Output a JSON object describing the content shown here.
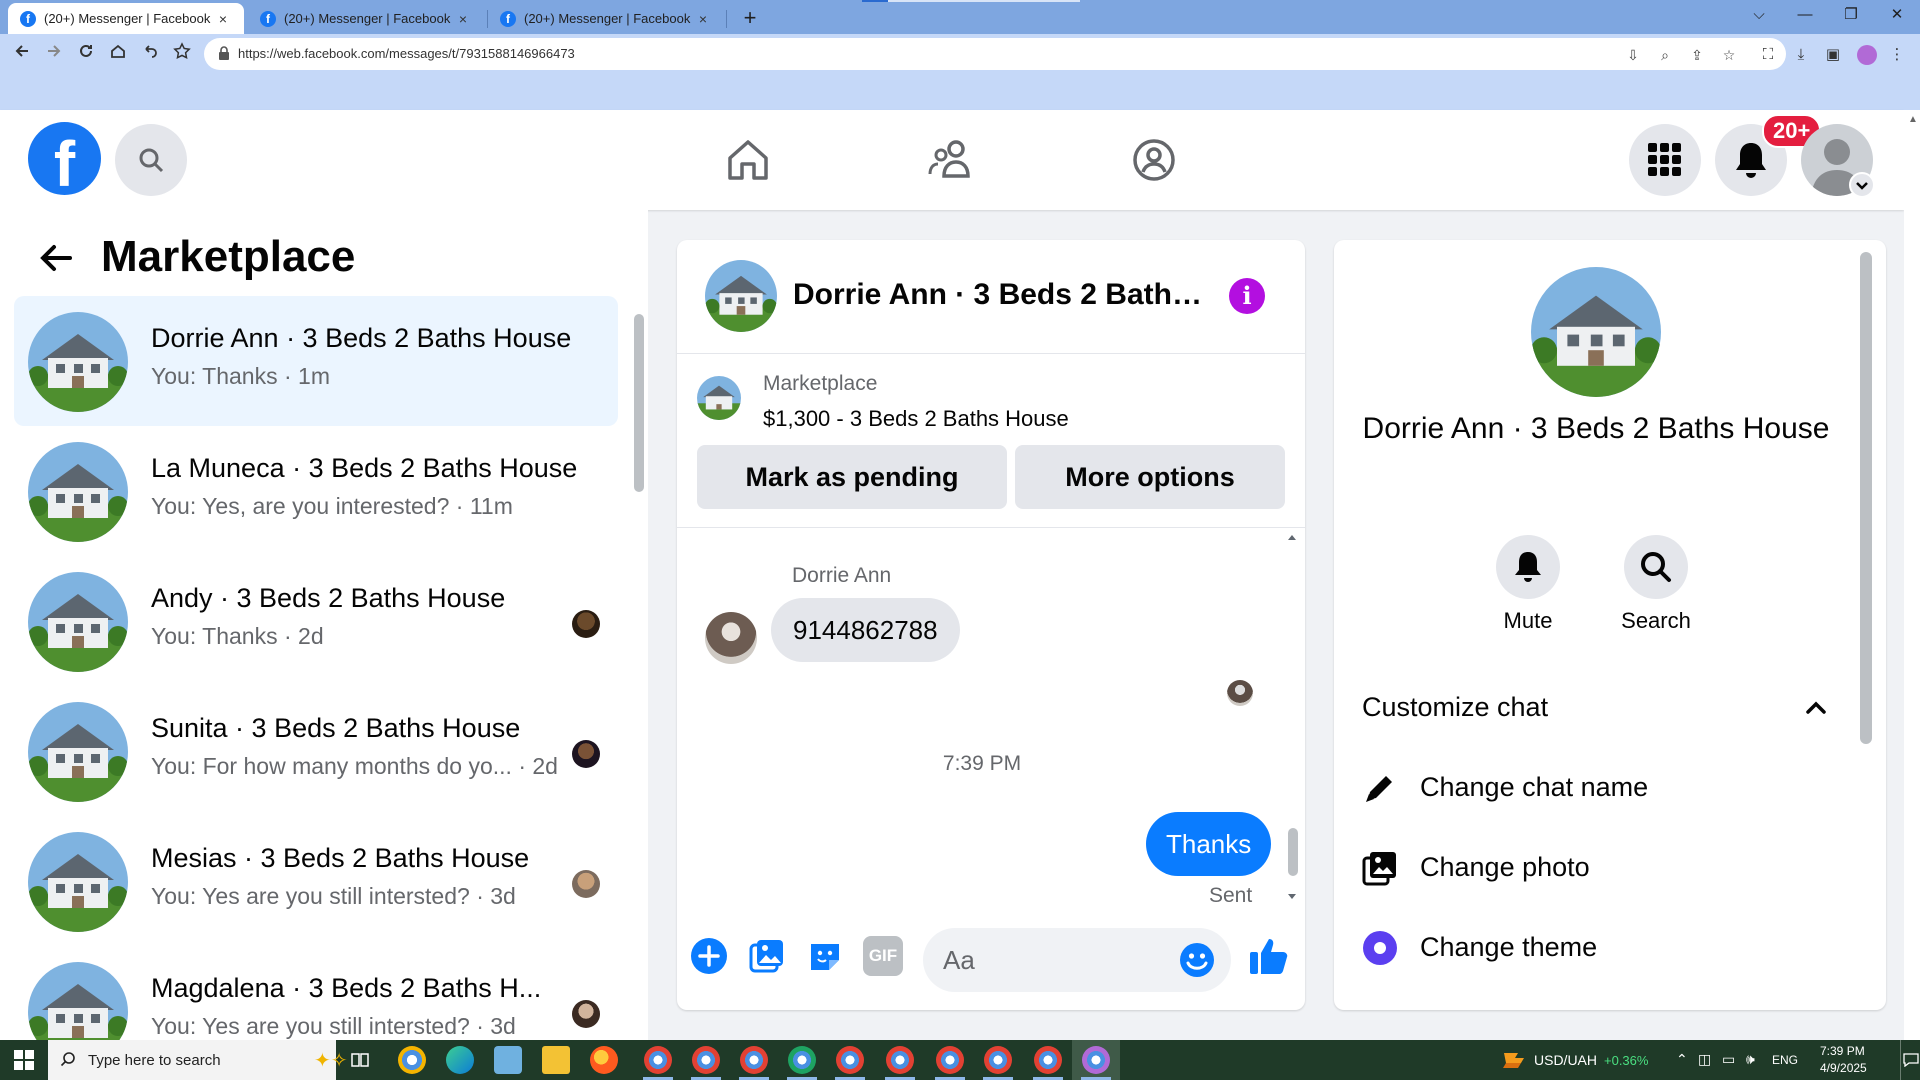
{
  "browser": {
    "tabs": [
      {
        "title": "(20+) Messenger | Facebook",
        "close": "×"
      },
      {
        "title": "(20+) Messenger | Facebook",
        "close": "×"
      },
      {
        "title": "(20+) Messenger | Facebook",
        "close": "×"
      }
    ],
    "new_tab": "+",
    "url": "https://web.facebook.com/messages/t/7931588146966473",
    "window_controls": {
      "tabs_menu": "⌵",
      "minimize": "—",
      "restore": "❐",
      "close": "✕"
    }
  },
  "facebook_header": {
    "logo": "f",
    "notification_badge": "20+"
  },
  "left_panel": {
    "title": "Marketplace",
    "conversations": [
      {
        "name": "Dorrie Ann · 3 Beds 2 Baths House",
        "preview": "You: Thanks · 1m",
        "selected": true
      },
      {
        "name": "La Muneca · 3 Beds 2 Baths House",
        "preview": "You: Yes, are you interested? · 11m"
      },
      {
        "name": "Andy · 3 Beds 2 Baths House",
        "preview": "You: Thanks · 2d"
      },
      {
        "name": "Sunita · 3 Beds 2 Baths House",
        "preview": "You: For how many months do yo... · 2d"
      },
      {
        "name": "Mesias · 3 Beds 2 Baths House",
        "preview": "You: Yes are you still intersted? · 3d"
      },
      {
        "name": "Magdalena · 3 Beds 2 Baths H...",
        "preview": "You: Yes are you still intersted? · 3d"
      }
    ]
  },
  "chat": {
    "header_name": "Dorrie Ann · 3 Beds 2 Baths House",
    "info_symbol": "i",
    "listing": {
      "source": "Marketplace",
      "title": "$1,300 - 3 Beds 2 Baths House",
      "mark_pending": "Mark as pending",
      "more_options": "More options"
    },
    "messages": {
      "sender": "Dorrie Ann",
      "incoming": "9144862788",
      "time": "7:39 PM",
      "outgoing": "Thanks",
      "status": "Sent"
    },
    "composer": {
      "placeholder": "Aa",
      "gif": "GIF"
    }
  },
  "info_panel": {
    "name": "Dorrie Ann · 3 Beds 2 Baths House",
    "mute": "Mute",
    "search": "Search",
    "section": "Customize chat",
    "options": [
      "Change chat name",
      "Change photo",
      "Change theme"
    ]
  },
  "taskbar": {
    "search_placeholder": "Type here to search",
    "currency": "USD/UAH",
    "currency_change": "+0.36%",
    "language": "ENG",
    "time": "7:39 PM",
    "date": "4/9/2025"
  },
  "colors": {
    "facebook_blue": "#1877f2",
    "messenger_blue": "#0a7cff",
    "info_purple": "#b30fe0",
    "badge_red": "#e41e3f",
    "theme_purple": "#5b3ff0"
  }
}
